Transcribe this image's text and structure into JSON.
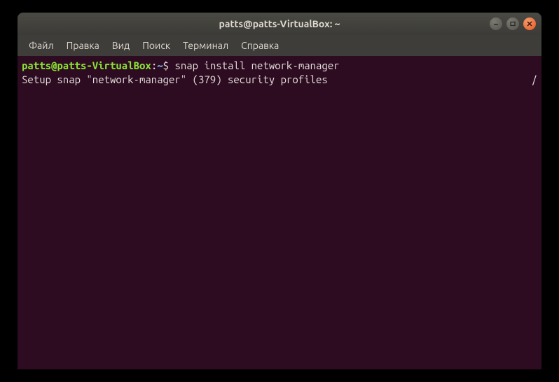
{
  "window": {
    "title": "patts@patts-VirtualBox: ~"
  },
  "menubar": {
    "items": [
      {
        "label": "Файл"
      },
      {
        "label": "Правка"
      },
      {
        "label": "Вид"
      },
      {
        "label": "Поиск"
      },
      {
        "label": "Терминал"
      },
      {
        "label": "Справка"
      }
    ]
  },
  "terminal": {
    "prompt": {
      "user_host": "patts@patts-VirtualBox",
      "colon": ":",
      "path": "~",
      "dollar": "$"
    },
    "command": "snap install network-manager",
    "output": "Setup snap \"network-manager\" (379) security profiles",
    "spinner": "/"
  }
}
